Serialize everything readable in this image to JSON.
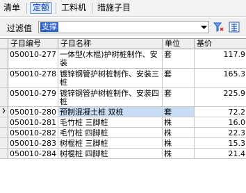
{
  "tabs": [
    {
      "label": "清单",
      "active": false
    },
    {
      "label": "定额",
      "active": true
    },
    {
      "label": "工料机",
      "active": false
    },
    {
      "label": "措施子目",
      "active": false
    }
  ],
  "filter": {
    "label": "过滤值",
    "value": "支撑"
  },
  "grid": {
    "columns": [
      "子目编号",
      "子目名称",
      "单位",
      "基价"
    ],
    "rows": [
      {
        "code": "050010-277",
        "name": "一体型(木棍)护树桩制作、安装",
        "unit": "套",
        "price": "117.9"
      },
      {
        "code": "050010-278",
        "name": "镀锌钢管护树桩制作、安装三桩",
        "unit": "套",
        "price": "165.3"
      },
      {
        "code": "050010-279",
        "name": "镀锌钢管护树桩制作、安装四桩",
        "unit": "套",
        "price": "225.9"
      },
      {
        "code": "050010-280",
        "name": "预制混凝土桩 双桩",
        "unit": "套",
        "price": "72.2"
      },
      {
        "code": "050010-281",
        "name": "毛竹桩 三脚桩",
        "unit": "株",
        "price": "16.0"
      },
      {
        "code": "050010-282",
        "name": "毛竹桩 四脚桩",
        "unit": "株",
        "price": "22.3"
      },
      {
        "code": "050010-283",
        "name": "树棍桩 三脚桩",
        "unit": "株",
        "price": "15.3"
      },
      {
        "code": "050010-284",
        "name": "树棍桩 四脚桩",
        "unit": "株",
        "price": "21.4"
      }
    ],
    "selected_index": 3
  },
  "icons": {
    "filter": "filter-funnel-icon",
    "toggle": "grid-toggle-icon"
  }
}
